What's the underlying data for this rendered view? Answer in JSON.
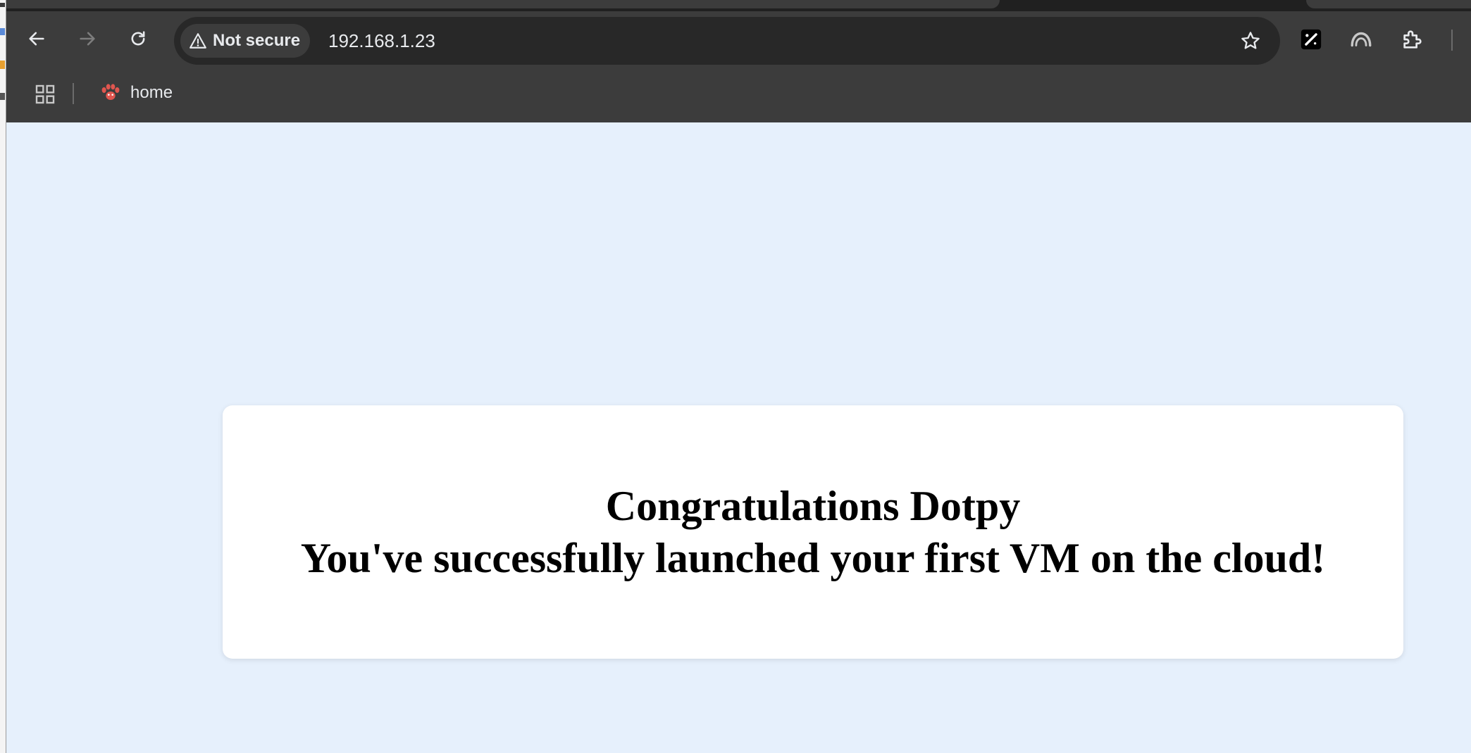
{
  "browser": {
    "security_label": "Not secure",
    "url": "192.168.1.23",
    "bookmarks": [
      {
        "label": "home"
      }
    ]
  },
  "colors": {
    "chrome_bg": "#3c3c3c",
    "omnibox_bg": "#282828",
    "page_bg": "#e6f0fc",
    "card_bg": "#ffffff",
    "bookmark_icon": "#e0564f"
  },
  "page": {
    "heading_line1": "Congratulations Dotpy",
    "heading_line2": "You've successfully launched your first VM on the cloud!"
  },
  "icons": {
    "back": "arrow-left-icon",
    "forward": "arrow-right-icon",
    "reload": "reload-icon",
    "security": "warning-triangle-icon",
    "bookmark_star": "star-icon",
    "extension_1": "pen-tool-icon",
    "extension_2": "arc-logo-icon",
    "extensions_menu": "puzzle-piece-icon",
    "apps": "apps-grid-icon",
    "bookmark_favicon": "paw-icon"
  }
}
